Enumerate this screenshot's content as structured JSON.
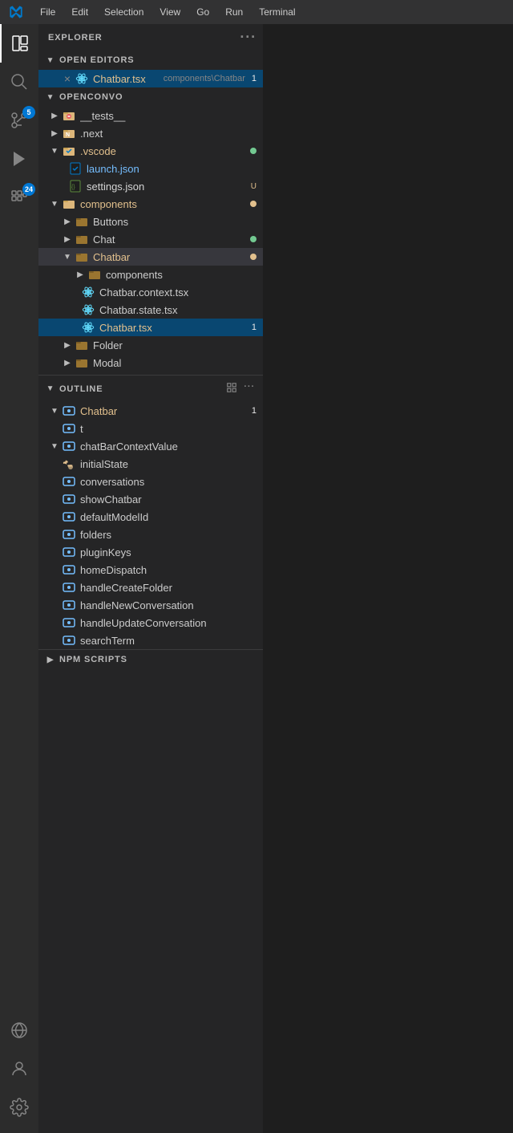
{
  "titlebar": {
    "menu_items": [
      "File",
      "Edit",
      "Selection",
      "View",
      "Go",
      "Run",
      "Terminal"
    ]
  },
  "activity_bar": {
    "items": [
      {
        "name": "explorer",
        "label": "Explorer",
        "active": true
      },
      {
        "name": "search",
        "label": "Search"
      },
      {
        "name": "source-control",
        "label": "Source Control",
        "badge": "5"
      },
      {
        "name": "run-debug",
        "label": "Run and Debug"
      },
      {
        "name": "extensions",
        "label": "Extensions",
        "badge": "24"
      }
    ],
    "bottom_items": [
      {
        "name": "remote",
        "label": "Remote"
      },
      {
        "name": "account",
        "label": "Account"
      },
      {
        "name": "settings",
        "label": "Settings"
      }
    ]
  },
  "explorer": {
    "title": "EXPLORER",
    "open_editors": {
      "label": "OPEN EDITORS",
      "files": [
        {
          "name": "Chatbar.tsx",
          "path": "components\\Chatbar",
          "badge": "1",
          "active": true
        }
      ]
    },
    "project": {
      "label": "OPENCONVO",
      "tree": [
        {
          "type": "folder",
          "name": "__tests__",
          "indent": 1,
          "collapsed": true,
          "icon": "test-folder"
        },
        {
          "type": "folder",
          "name": ".next",
          "indent": 1,
          "collapsed": true,
          "icon": "next-folder"
        },
        {
          "type": "folder",
          "name": ".vscode",
          "indent": 1,
          "collapsed": false,
          "icon": "vscode-folder",
          "decoration": "dot-green"
        },
        {
          "type": "file",
          "name": "launch.json",
          "indent": 2,
          "icon": "vscode-file"
        },
        {
          "type": "file",
          "name": "settings.json",
          "indent": 2,
          "icon": "json-file",
          "decoration": "U"
        },
        {
          "type": "folder",
          "name": "components",
          "indent": 1,
          "collapsed": false,
          "icon": "folder-yellow",
          "decoration": "dot-yellow"
        },
        {
          "type": "folder",
          "name": "Buttons",
          "indent": 2,
          "collapsed": true,
          "icon": "folder-brown"
        },
        {
          "type": "folder",
          "name": "Chat",
          "indent": 2,
          "collapsed": true,
          "icon": "folder-brown",
          "decoration": "dot-green"
        },
        {
          "type": "folder",
          "name": "Chatbar",
          "indent": 2,
          "collapsed": false,
          "icon": "folder-brown",
          "decoration": "dot-yellow"
        },
        {
          "type": "folder",
          "name": "components",
          "indent": 3,
          "collapsed": true,
          "icon": "folder-brown"
        },
        {
          "type": "file",
          "name": "Chatbar.context.tsx",
          "indent": 3,
          "icon": "react-file"
        },
        {
          "type": "file",
          "name": "Chatbar.state.tsx",
          "indent": 3,
          "icon": "react-file"
        },
        {
          "type": "file",
          "name": "Chatbar.tsx",
          "indent": 3,
          "icon": "react-file",
          "decoration": "1",
          "active": true
        },
        {
          "type": "folder",
          "name": "Folder",
          "indent": 2,
          "collapsed": true,
          "icon": "folder-brown"
        },
        {
          "type": "folder",
          "name": "Modal",
          "indent": 2,
          "collapsed": true,
          "icon": "folder-brown"
        }
      ]
    }
  },
  "outline": {
    "title": "OUTLINE",
    "items": [
      {
        "type": "class",
        "name": "Chatbar",
        "indent": 1,
        "collapsed": false,
        "badge": "1"
      },
      {
        "type": "class",
        "name": "t",
        "indent": 2
      },
      {
        "type": "class",
        "name": "chatBarContextValue",
        "indent": 2,
        "collapsed": false
      },
      {
        "type": "property",
        "name": "initialState",
        "indent": 3
      },
      {
        "type": "class",
        "name": "conversations",
        "indent": 3
      },
      {
        "type": "class",
        "name": "showChatbar",
        "indent": 3
      },
      {
        "type": "class",
        "name": "defaultModelId",
        "indent": 3
      },
      {
        "type": "class",
        "name": "folders",
        "indent": 3
      },
      {
        "type": "class",
        "name": "pluginKeys",
        "indent": 3
      },
      {
        "type": "class",
        "name": "homeDispatch",
        "indent": 3
      },
      {
        "type": "class",
        "name": "handleCreateFolder",
        "indent": 3
      },
      {
        "type": "class",
        "name": "handleNewConversation",
        "indent": 3
      },
      {
        "type": "class",
        "name": "handleUpdateConversation",
        "indent": 3
      },
      {
        "type": "class",
        "name": "searchTerm",
        "indent": 3
      }
    ]
  },
  "npm_scripts": {
    "title": "NPM SCRIPTS"
  }
}
